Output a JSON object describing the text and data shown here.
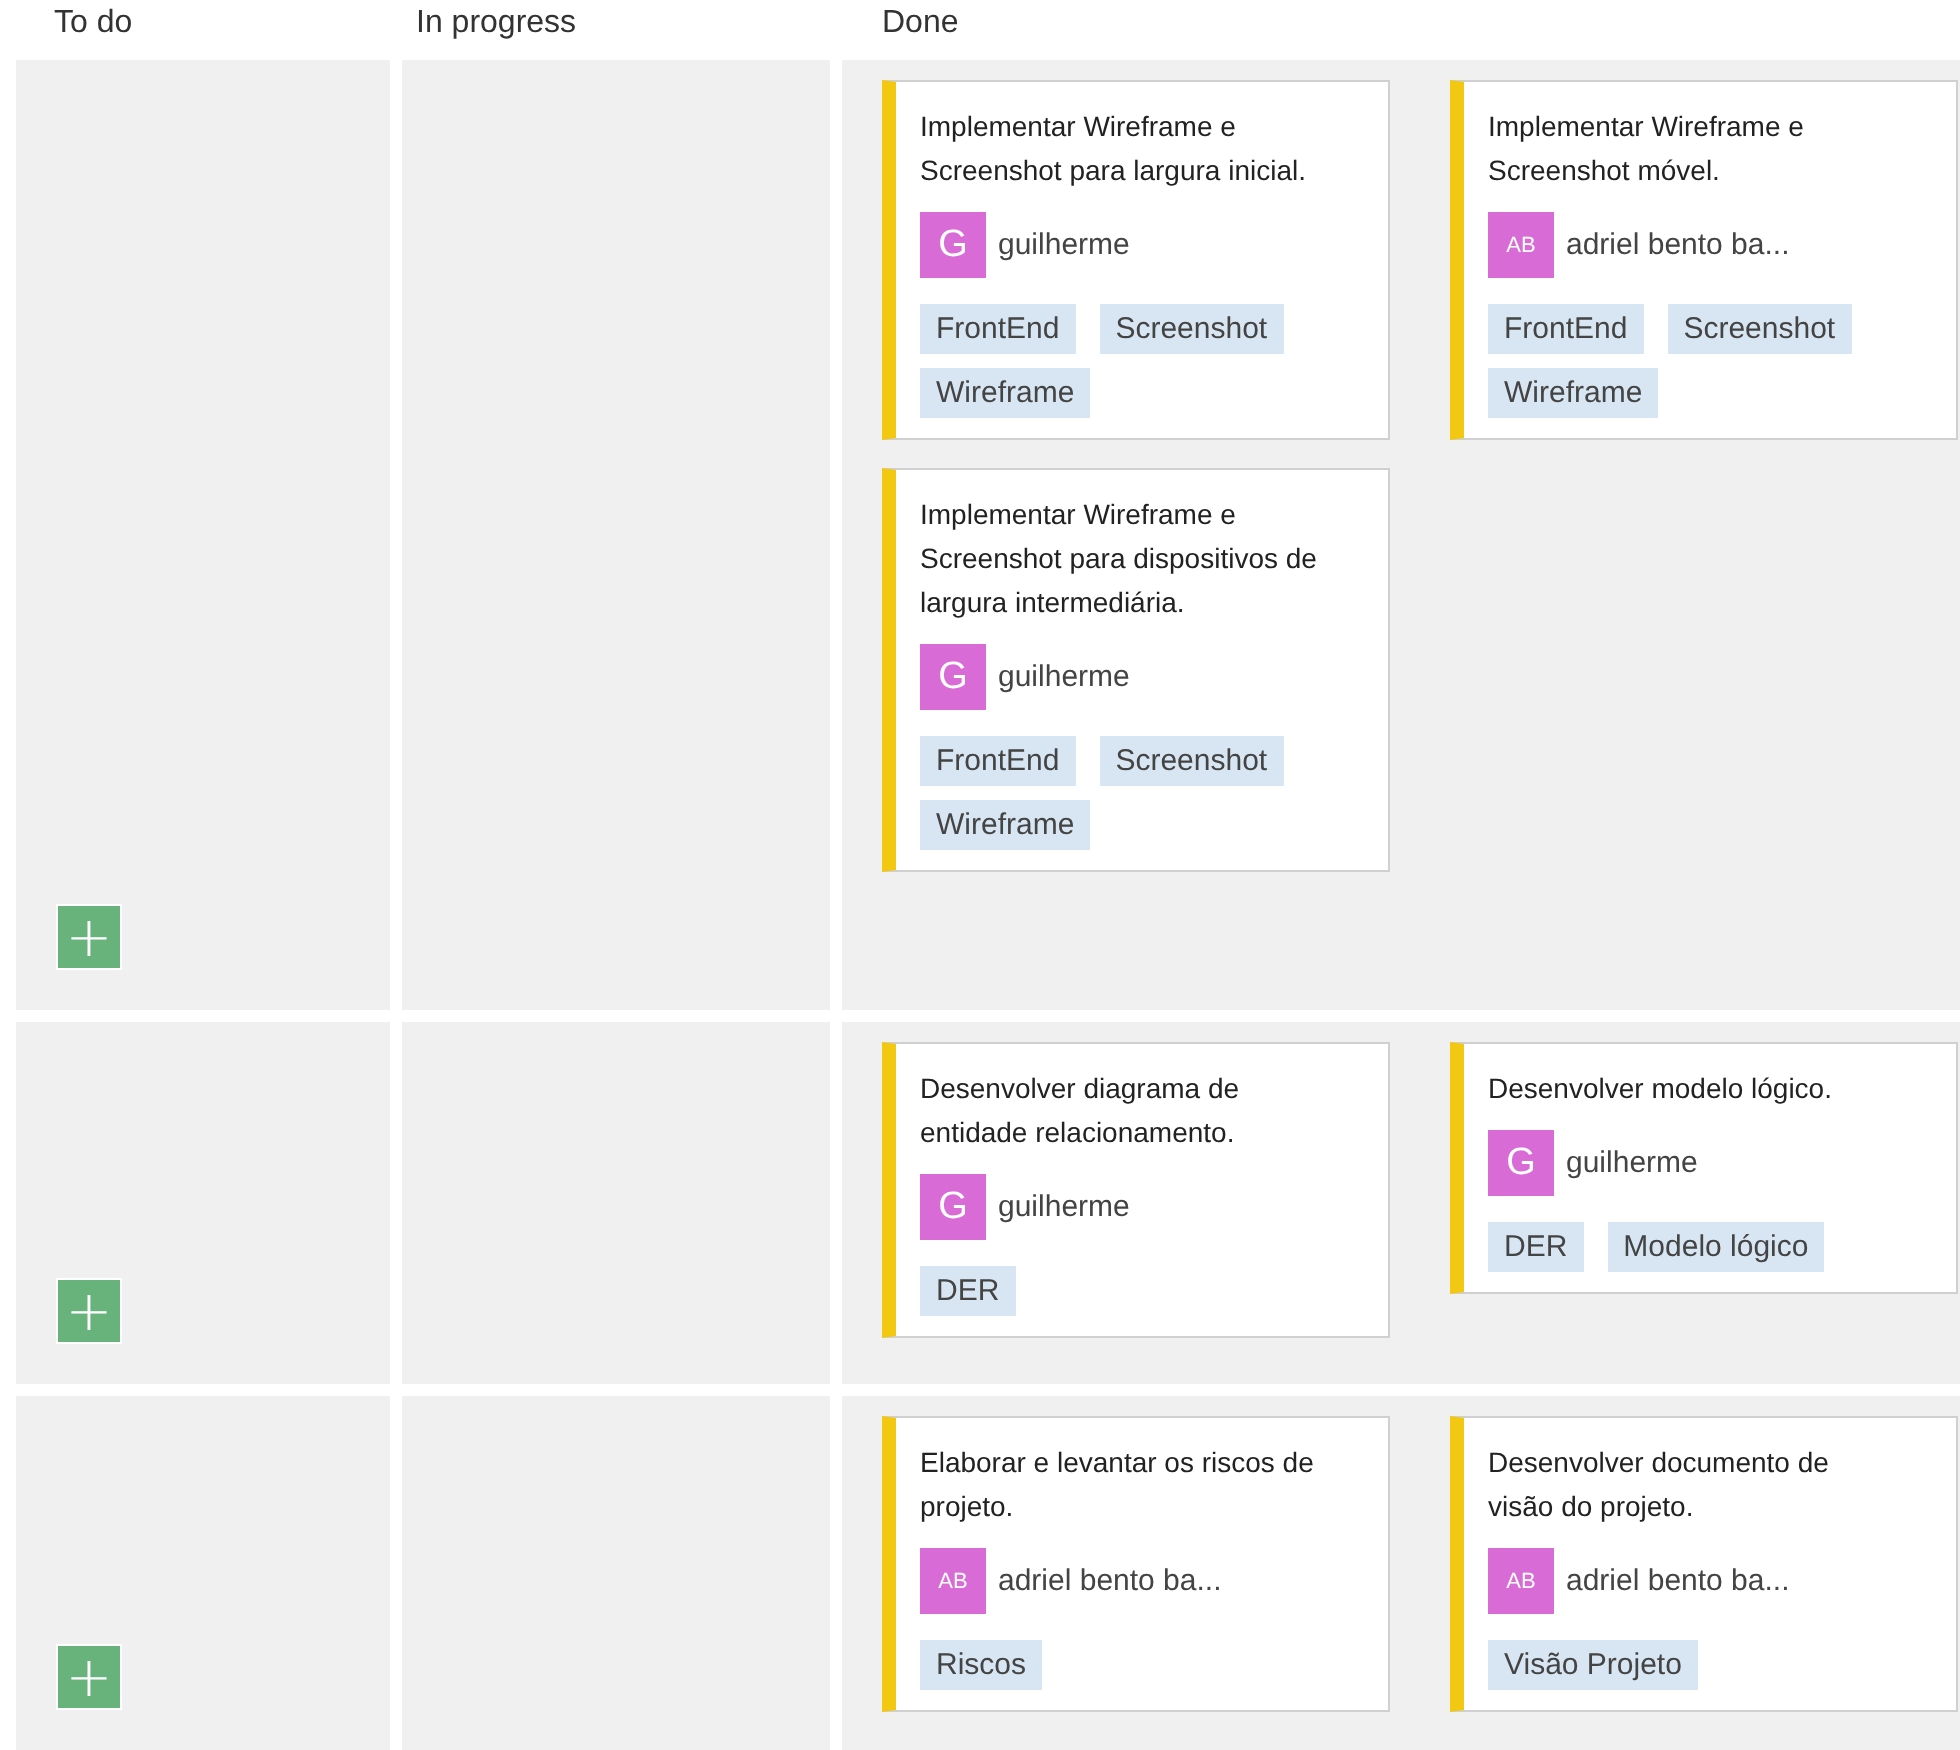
{
  "columns": [
    {
      "label": "To do"
    },
    {
      "label": "In progress"
    },
    {
      "label": "Done"
    }
  ],
  "swimlanes": [
    {
      "add_button": "+",
      "done": [
        {
          "title": "Implementar Wireframe e Screenshot  para largura inicial.",
          "assignee": {
            "initials": "G",
            "name": "guilherme"
          },
          "tags": [
            "FrontEnd",
            "Screenshot",
            "Wireframe"
          ]
        },
        {
          "title": "Implementar Wireframe e Screenshot móvel.",
          "assignee": {
            "initials": "AB",
            "name": "adriel bento ba..."
          },
          "tags": [
            "FrontEnd",
            "Screenshot",
            "Wireframe"
          ]
        },
        {
          "title": "Implementar Wireframe e Screenshot para dispositivos de largura intermediária.",
          "assignee": {
            "initials": "G",
            "name": "guilherme"
          },
          "tags": [
            "FrontEnd",
            "Screenshot",
            "Wireframe"
          ]
        }
      ]
    },
    {
      "add_button": "+",
      "done": [
        {
          "title": "Desenvolver diagrama de entidade relacionamento.",
          "assignee": {
            "initials": "G",
            "name": "guilherme"
          },
          "tags": [
            "DER"
          ]
        },
        {
          "title": "Desenvolver modelo lógico.",
          "assignee": {
            "initials": "G",
            "name": "guilherme"
          },
          "tags": [
            "DER",
            "Modelo lógico"
          ]
        }
      ]
    },
    {
      "add_button": "+",
      "done": [
        {
          "title": "Elaborar e levantar os riscos de projeto.",
          "assignee": {
            "initials": "AB",
            "name": "adriel bento ba..."
          },
          "tags": [
            "Riscos"
          ]
        },
        {
          "title": "Desenvolver documento de visão do projeto.",
          "assignee": {
            "initials": "AB",
            "name": "adriel bento ba..."
          },
          "tags": [
            "Visão Projeto"
          ]
        }
      ]
    }
  ]
}
